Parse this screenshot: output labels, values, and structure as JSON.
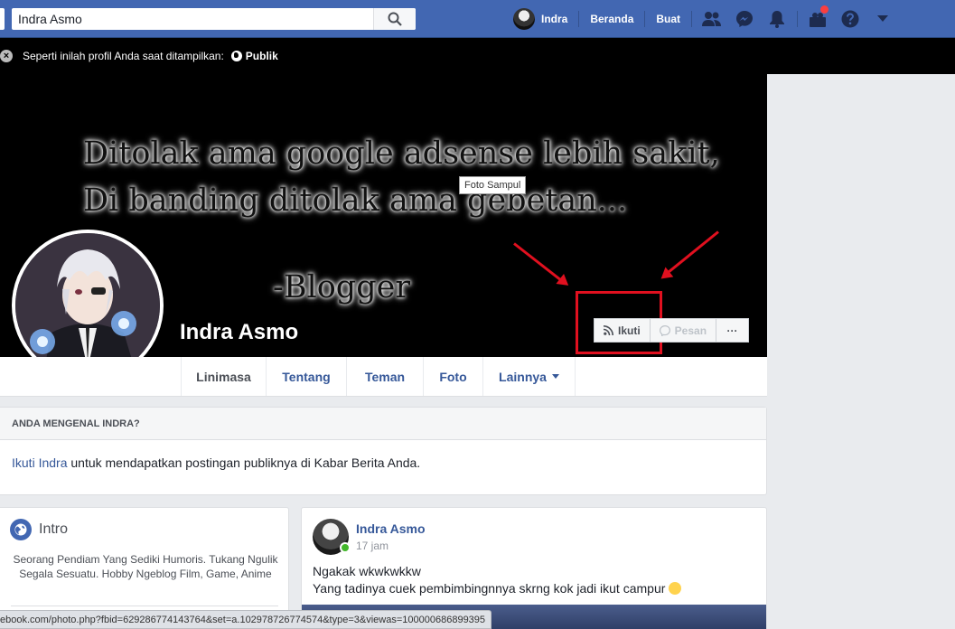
{
  "topbar": {
    "search_value": "Indra Asmo",
    "user_name": "Indra",
    "home": "Beranda",
    "create": "Buat"
  },
  "preview": {
    "text": "Seperti inilah profil Anda saat ditampilkan:",
    "visibility": "Publik"
  },
  "cover": {
    "quote_line1": "Ditolak ama google adsense lebih sakit,",
    "quote_line2": "Di banding ditolak ama gebetan...",
    "signature": "-Blogger",
    "tooltip": "Foto Sampul"
  },
  "profile": {
    "name": "Indra Asmo",
    "follow_label": "Ikuti",
    "message_label": "Pesan",
    "more_label": "···"
  },
  "tabs": [
    "Linimasa",
    "Tentang",
    "Teman",
    "Foto",
    "Lainnya"
  ],
  "know": {
    "heading": "ANDA MENGENAL INDRA?",
    "link": "Ikuti Indra",
    "text": " untuk mendapatkan postingan publiknya di Kabar Berita Anda."
  },
  "intro": {
    "title": "Intro",
    "bio": "Seorang Pendiam Yang Sediki Humoris. Tukang Ngulik Segala Sesuatu. Hobby Ngeblog Film, Game, Anime"
  },
  "post": {
    "author": "Indra Asmo",
    "time": "17 jam",
    "line1": "Ngakak wkwkwkkw",
    "line2": "Yang tadinya cuek pembimbingnnya skrng kok jadi ikut campur"
  },
  "statusbar": {
    "url": "ebook.com/photo.php?fbid=629286774143764&set=a.102978726774574&type=3&viewas=100000686899395"
  },
  "colors": {
    "brand": "#4267b2",
    "link": "#365899",
    "annotation": "#e0101f"
  }
}
